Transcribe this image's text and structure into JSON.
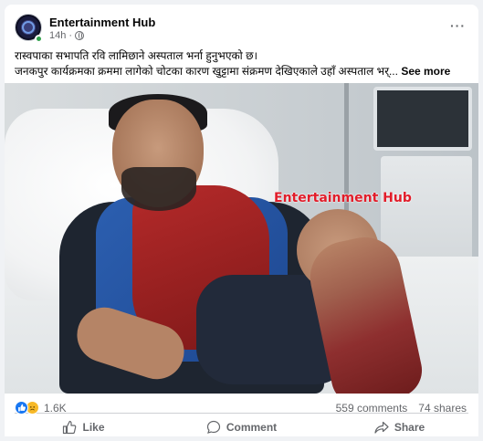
{
  "post": {
    "page_name": "Entertainment Hub",
    "time": "14h",
    "privacy_icon": "globe-icon",
    "more_label": "···",
    "caption_line1": "रास्वपाका सभापति रवि लामिछाने अस्पताल भर्ना हुनुभएको छ।",
    "caption_line2": "जनकपुर कार्यक्रमका क्रममा लागेको चोटका कारण खुट्टामा संक्रमण देखिएकाले उहाँ अस्पताल भर्...",
    "see_more": "See more",
    "image_watermark": "Entertainment Hub"
  },
  "stats": {
    "reaction_count": "1.6K",
    "reaction_icons": [
      "like-reaction-icon",
      "sad-reaction-icon"
    ],
    "comments": "559 comments",
    "shares": "74 shares"
  },
  "actions": {
    "like": "Like",
    "comment": "Comment",
    "share": "Share"
  },
  "colors": {
    "like_blue": "#1877f2",
    "sad_yellow": "#f7b928",
    "watermark_red": "#e11d2a",
    "online_green": "#31a24c",
    "muted_text": "#65676b"
  }
}
